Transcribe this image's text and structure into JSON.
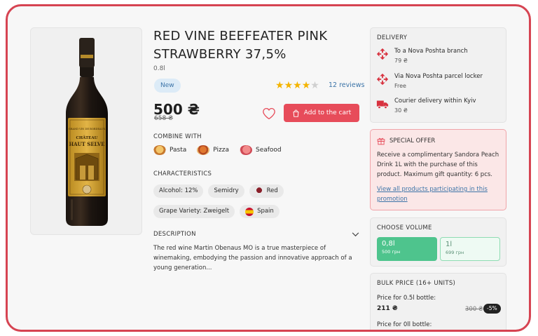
{
  "product": {
    "title": "RED VINE BEEFEATER PINK STRAWBERRY 37,5%",
    "volume": "0.8l",
    "badge": "New",
    "rating": 4,
    "reviews": "12 reviews",
    "price": "500 ₴",
    "old_price": "658 ₴",
    "add_to_cart": "Add to the cart",
    "bottle_label_top": "GRAND VIN DE BORDEAUX",
    "bottle_label_name": "CHÂTEAU HAUT SELVE"
  },
  "combine": {
    "label": "COMBINE WITH",
    "items": [
      {
        "label": "Pasta",
        "color": "#e8a24a"
      },
      {
        "label": "Pizza",
        "color": "#d9793a"
      },
      {
        "label": "Seafood",
        "color": "#e2636b"
      }
    ]
  },
  "characteristics": {
    "label": "CHARACTERISTICS",
    "row1": [
      "Alcohol: 12%",
      "Semidry",
      "Red"
    ],
    "row2": [
      "Grape Variety: Zweigelt",
      "Spain"
    ]
  },
  "description": {
    "label": "DESCRIPTION",
    "text": "The red wine Martin Obenaus MO is a true masterpiece of winemaking, embodying the passion and innovative approach of a young generation..."
  },
  "delivery": {
    "label": "DELIVERY",
    "options": [
      {
        "label": "To a Nova Poshta branch",
        "sub": "79 ₴",
        "icon": "nova-poshta-icon"
      },
      {
        "label": "Via Nova Poshta parcel locker",
        "sub": "Free",
        "icon": "nova-poshta-icon"
      },
      {
        "label": "Courier delivery within Kyiv",
        "sub": "30 ₴",
        "icon": "truck-icon"
      }
    ]
  },
  "special_offer": {
    "label": "SPECIAL OFFER",
    "text": "Receive a complimentary Sandora Peach Drink 1L with the purchase of this product. Maximum gift quantity: 6 pcs.",
    "link": "View all products participating in this promotion"
  },
  "choose_volume": {
    "label": "CHOOSE VOLUME",
    "options": [
      {
        "volume": "0,8l",
        "price": "500 грн"
      },
      {
        "volume": "1l",
        "price": "699 грн"
      }
    ]
  },
  "bulk": {
    "label": "BULK PRICE (16+ UNITS)",
    "row1_label": "Price for 0.5l bottle:",
    "row1_price": "211 ₴",
    "row1_old": "300 ₴",
    "row1_discount": "-5%",
    "row2_label": "Price for 0ll bottle:"
  },
  "colors": {
    "accent": "#e74c5a",
    "frame": "#d64452",
    "volume_selected": "#4ec48d",
    "link": "#3c74a8"
  }
}
